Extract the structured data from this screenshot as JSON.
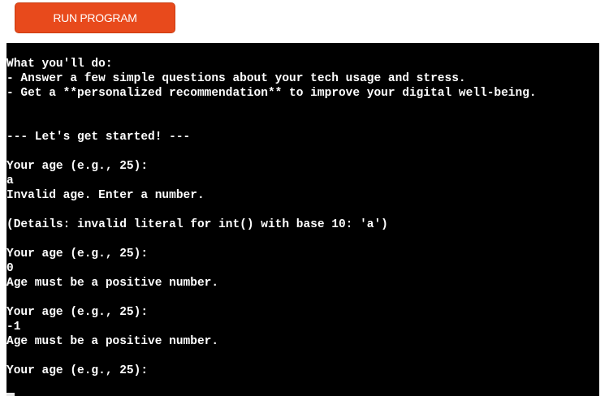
{
  "toolbar": {
    "run_label": "RUN PROGRAM",
    "run_color": "#e84a1c"
  },
  "terminal": {
    "background": "#000000",
    "text_color": "#ffffff",
    "lines": [
      "What you'll do:",
      "- Answer a few simple questions about your tech usage and stress.",
      "- Get a **personalized recommendation** to improve your digital well-being.",
      "",
      "",
      "--- Let's get started! ---",
      "",
      "Your age (e.g., 25):",
      "a",
      "Invalid age. Enter a number.",
      "",
      "(Details: invalid literal for int() with base 10: 'a')",
      "",
      "Your age (e.g., 25):",
      "0",
      "Age must be a positive number.",
      "",
      "Your age (e.g., 25):",
      "-1",
      "Age must be a positive number.",
      "",
      "Your age (e.g., 25):"
    ]
  }
}
